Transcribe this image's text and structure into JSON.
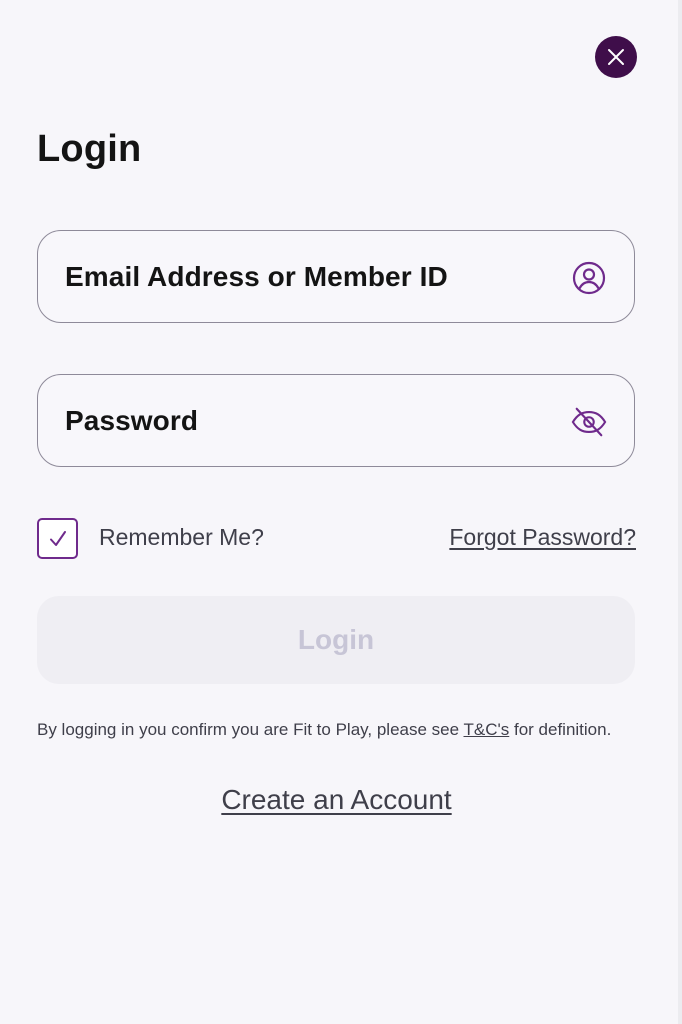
{
  "modal": {
    "title": "Login",
    "close_icon": "close-icon"
  },
  "email_field": {
    "placeholder": "Email Address or Member ID",
    "icon": "user-circle-icon"
  },
  "password_field": {
    "placeholder": "Password",
    "icon": "eye-off-icon"
  },
  "remember_me": {
    "label": "Remember Me?",
    "checked": true
  },
  "forgot_password": {
    "label": "Forgot Password?"
  },
  "login_button": {
    "label": "Login",
    "enabled": false
  },
  "disclaimer": {
    "prefix": "By logging in you confirm you are Fit to Play, please see ",
    "link": "T&C's",
    "suffix": " for definition."
  },
  "create_account": {
    "label": "Create an Account"
  },
  "colors": {
    "background": "#f7f6fa",
    "brand_purple": "#3f0e4a",
    "accent_purple": "#6f2a8c",
    "disabled_text": "#c7c5d6"
  }
}
